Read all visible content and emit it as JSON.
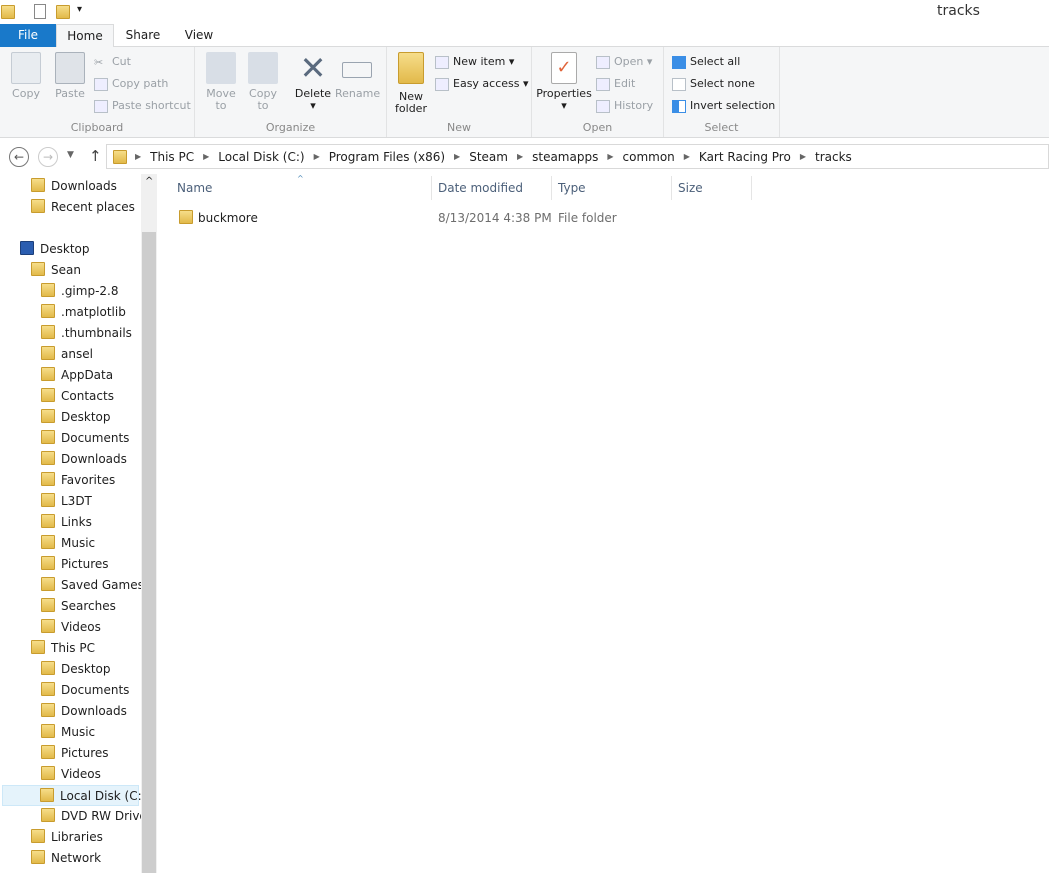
{
  "window": {
    "title": "tracks"
  },
  "ribbon_tabs": {
    "file": "File",
    "home": "Home",
    "share": "Share",
    "view": "View"
  },
  "clipboard": {
    "copy": "Copy",
    "paste": "Paste",
    "cut": "Cut",
    "copy_path": "Copy path",
    "paste_shortcut": "Paste shortcut",
    "label": "Clipboard"
  },
  "organize": {
    "move_to": "Move to",
    "copy_to": "Copy to",
    "delete": "Delete",
    "rename": "Rename",
    "label": "Organize"
  },
  "new": {
    "new_folder": "New folder",
    "new_item": "New item",
    "easy_access": "Easy access",
    "label": "New"
  },
  "open": {
    "properties": "Properties",
    "open": "Open",
    "edit": "Edit",
    "history": "History",
    "label": "Open"
  },
  "select": {
    "select_all": "Select all",
    "select_none": "Select none",
    "invert": "Invert selection",
    "label": "Select"
  },
  "breadcrumb": [
    "This PC",
    "Local Disk (C:)",
    "Program Files (x86)",
    "Steam",
    "steamapps",
    "common",
    "Kart Racing Pro",
    "tracks"
  ],
  "nav": [
    {
      "label": "Downloads",
      "level": 1
    },
    {
      "label": "Recent places",
      "level": 1
    },
    {
      "label": "",
      "level": -1
    },
    {
      "label": "Desktop",
      "level": 0
    },
    {
      "label": "Sean",
      "level": 1
    },
    {
      "label": ".gimp-2.8",
      "level": 2
    },
    {
      "label": ".matplotlib",
      "level": 2
    },
    {
      "label": ".thumbnails",
      "level": 2
    },
    {
      "label": "ansel",
      "level": 2
    },
    {
      "label": "AppData",
      "level": 2
    },
    {
      "label": "Contacts",
      "level": 2
    },
    {
      "label": "Desktop",
      "level": 2
    },
    {
      "label": "Documents",
      "level": 2
    },
    {
      "label": "Downloads",
      "level": 2
    },
    {
      "label": "Favorites",
      "level": 2
    },
    {
      "label": "L3DT",
      "level": 2
    },
    {
      "label": "Links",
      "level": 2
    },
    {
      "label": "Music",
      "level": 2
    },
    {
      "label": "Pictures",
      "level": 2
    },
    {
      "label": "Saved Games",
      "level": 2
    },
    {
      "label": "Searches",
      "level": 2
    },
    {
      "label": "Videos",
      "level": 2
    },
    {
      "label": "This PC",
      "level": 1
    },
    {
      "label": "Desktop",
      "level": 2
    },
    {
      "label": "Documents",
      "level": 2
    },
    {
      "label": "Downloads",
      "level": 2
    },
    {
      "label": "Music",
      "level": 2
    },
    {
      "label": "Pictures",
      "level": 2
    },
    {
      "label": "Videos",
      "level": 2
    },
    {
      "label": "Local Disk (C:)",
      "level": 2,
      "selected": true
    },
    {
      "label": "DVD RW Drive (",
      "level": 2
    },
    {
      "label": "Libraries",
      "level": 1
    },
    {
      "label": "Network",
      "level": 1
    }
  ],
  "columns": {
    "name": "Name",
    "date": "Date modified",
    "type": "Type",
    "size": "Size"
  },
  "files": [
    {
      "name": "buckmore",
      "date": "8/13/2014 4:38 PM",
      "type": "File folder",
      "size": ""
    }
  ]
}
